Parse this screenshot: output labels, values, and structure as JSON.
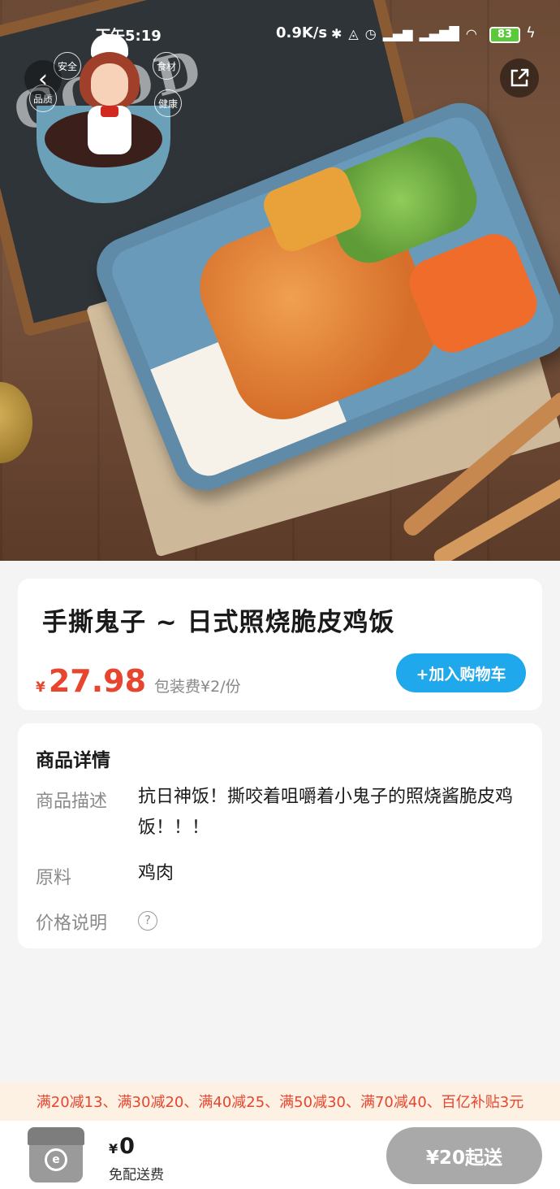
{
  "status_bar": {
    "time": "下午5:19",
    "network_speed": "0.9K/s",
    "battery": "83",
    "battery_color": "#5aca3a"
  },
  "hero": {
    "board_text": "GOOD",
    "badge_tags": [
      "品质",
      "食材",
      "健康",
      "安全"
    ]
  },
  "product": {
    "name": "手撕鬼子 ~ 日式照烧脆皮鸡饭",
    "currency": "¥",
    "price": "27.98",
    "packaging_fee": "包装费¥2/份",
    "add_to_cart_label": "+加入购物车",
    "accent_color": "#20a8ec",
    "price_color": "#e8452e"
  },
  "details": {
    "title": "商品详情",
    "rows": [
      {
        "label": "商品描述",
        "value": "抗日神饭！撕咬着咀嚼着小鬼子的照烧酱脆皮鸡饭！！！"
      },
      {
        "label": "原料",
        "value": "鸡肉"
      },
      {
        "label": "价格说明",
        "value": "?"
      }
    ]
  },
  "promo": {
    "text": "满20减13、满30减20、满40减25、满50减30、满70减40、百亿补贴3元"
  },
  "bottom_bar": {
    "currency": "¥",
    "total": "0",
    "delivery_label": "免配送费",
    "checkout_label": "¥20起送",
    "cart_icon": "cart-box-icon"
  }
}
